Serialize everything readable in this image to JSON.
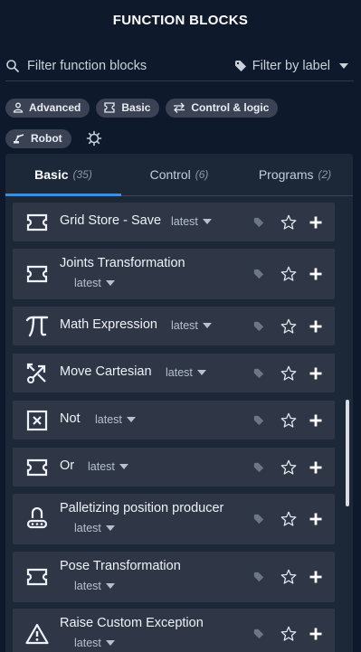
{
  "header": {
    "title": "FUNCTION BLOCKS"
  },
  "search": {
    "placeholder": "Filter function blocks"
  },
  "label_filter": {
    "label": "Filter by label"
  },
  "chips": [
    {
      "label": "Advanced",
      "icon": "person-icon"
    },
    {
      "label": "Basic",
      "icon": "block-icon"
    },
    {
      "label": "Control & logic",
      "icon": "arrows-swap-icon"
    },
    {
      "label": "Robot",
      "icon": "robot-arm-icon"
    }
  ],
  "tabs": [
    {
      "label": "Basic",
      "count": "(35)",
      "active": true
    },
    {
      "label": "Control",
      "count": "(6)",
      "active": false
    },
    {
      "label": "Programs",
      "count": "(2)",
      "active": false
    }
  ],
  "items": [
    {
      "name": "Grid Store - Save",
      "version": "latest",
      "icon": "block-icon"
    },
    {
      "name": "Joints Transformation",
      "version": "latest",
      "icon": "block-icon"
    },
    {
      "name": "Math Expression",
      "version": "latest",
      "icon": "pi-icon"
    },
    {
      "name": "Move Cartesian",
      "version": "latest",
      "icon": "move-cartesian-icon"
    },
    {
      "name": "Not",
      "version": "latest",
      "icon": "not-box-icon"
    },
    {
      "name": "Or",
      "version": "latest",
      "icon": "block-icon"
    },
    {
      "name": "Palletizing position producer",
      "version": "latest",
      "icon": "palletizer-icon"
    },
    {
      "name": "Pose Transformation",
      "version": "latest",
      "icon": "block-icon"
    },
    {
      "name": "Raise Custom Exception",
      "version": "latest",
      "icon": "warning-icon"
    }
  ],
  "colors": {
    "background": "#0e1a2b",
    "panel": "#1c2738",
    "card": "#2f3747",
    "chip": "#3a4254",
    "accent": "#3d8fdb"
  }
}
